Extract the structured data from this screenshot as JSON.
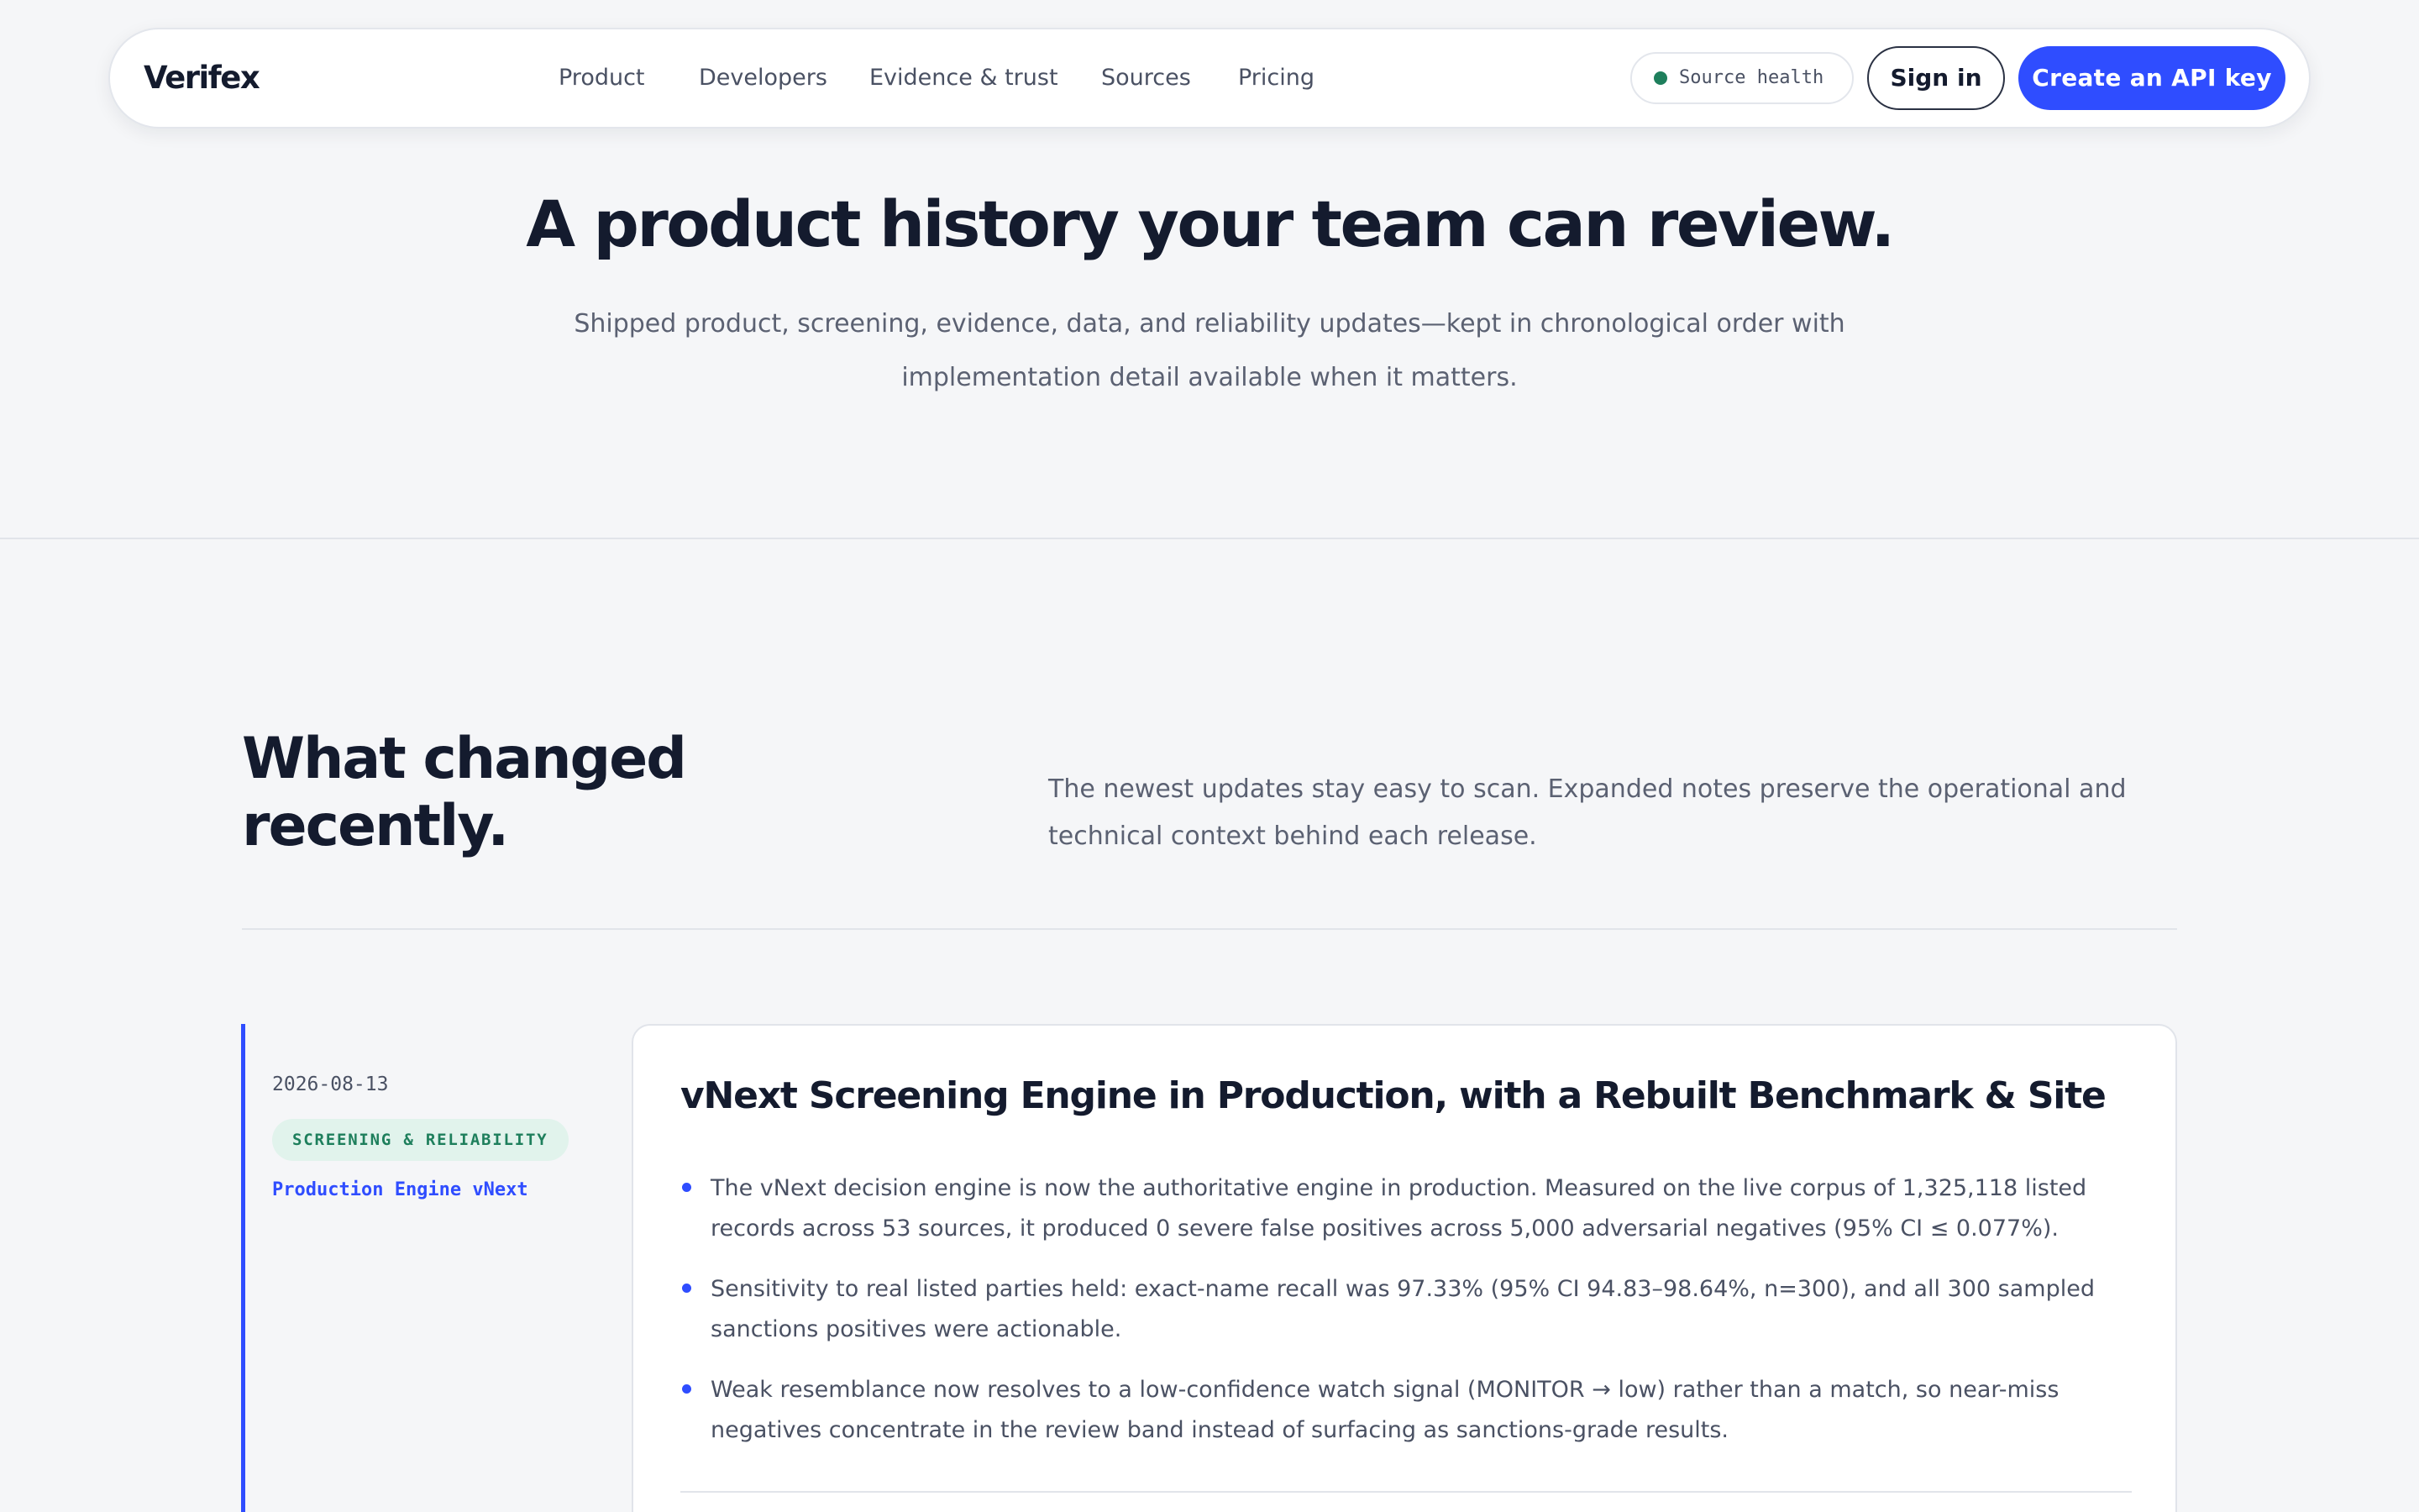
{
  "nav": {
    "logo": "Verifex",
    "links": [
      "Product",
      "Developers",
      "Evidence & trust",
      "Sources",
      "Pricing"
    ],
    "source_health": "Source health",
    "sign_in": "Sign in",
    "cta": "Create an API key"
  },
  "hero": {
    "title": "A product history your team can review.",
    "subtitle": "Shipped product, screening, evidence, data, and reliability updates—kept in chronological order with implementation detail available when it matters."
  },
  "recent": {
    "title": "What changed recently.",
    "description": "The newest updates stay easy to scan. Expanded notes preserve the operational and technical context behind each release."
  },
  "entry": {
    "date": "2026-08-13",
    "category": "SCREENING & RELIABILITY",
    "version": "Production Engine vNext",
    "title": "vNext Screening Engine in Production, with a Rebuilt Benchmark & Site",
    "bullets": [
      "The vNext decision engine is now the authoritative engine in production. Measured on the live corpus of 1,325,118 listed records across 53 sources, it produced 0 severe false positives across 5,000 adversarial negatives (95% CI ≤ 0.077%).",
      "Sensitivity to real listed parties held: exact-name recall was 97.33% (95% CI 94.83–98.64%, n=300), and all 300 sampled sanctions positives were actionable.",
      "Weak resemblance now resolves to a low-confidence watch signal (MONITOR → low) rather than a match, so near-miss negatives concentrate in the review band instead of surfacing as sanctions-grade results."
    ]
  },
  "colors": {
    "accent": "#2f4dff",
    "health_ok": "#1e7f5c",
    "badge_bg": "#e1f3ec",
    "page_bg": "#f5f6f8"
  }
}
